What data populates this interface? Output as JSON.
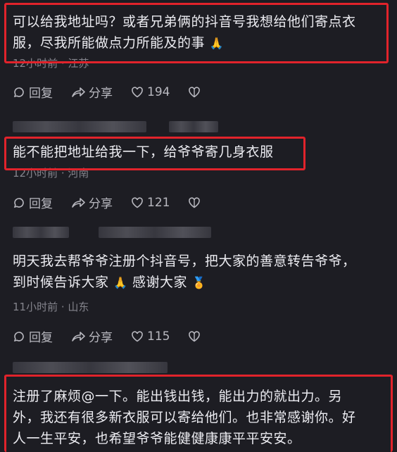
{
  "comments": [
    {
      "text_line1": "可以给我地址吗？或者兄弟俩的抖音号我想给他们寄点衣",
      "text_line2": "服，尽我所能做点力所能及的事",
      "emoji": "🙏",
      "meta": "12小时前 · 江苏",
      "reply_label": "回复",
      "share_label": "分享",
      "likes": "194"
    },
    {
      "text_line1": "能不能把地址给我一下，给爷爷寄几身衣服",
      "meta": "12小时前 · 河南",
      "reply_label": "回复",
      "share_label": "分享",
      "likes": "121"
    },
    {
      "text_line1": "明天我去帮爷爷注册个抖音号，把大家的善意转告爷爷，",
      "text_line2": "到时候告诉大家",
      "emoji": "🙏",
      "text_line2b": "感谢大家",
      "emoji2": "🏅",
      "meta": "11小时前 · 山东",
      "reply_label": "回复",
      "share_label": "分享",
      "likes": "115"
    },
    {
      "text_line1": "注册了麻烦@一下。能出钱出钱，能出力的就出力。另",
      "text_line2": "外，我还有很多新衣服可以寄给他们。也非常感谢你。好",
      "text_line3": "人一生平安，也希望爷爷能健健康康平平安安。"
    }
  ],
  "colors": {
    "background": "#1d1d23",
    "highlight": "#e1232b",
    "meta": "#84848c"
  },
  "icons": [
    "reply-icon",
    "share-icon",
    "heart-icon",
    "dislike-icon"
  ]
}
